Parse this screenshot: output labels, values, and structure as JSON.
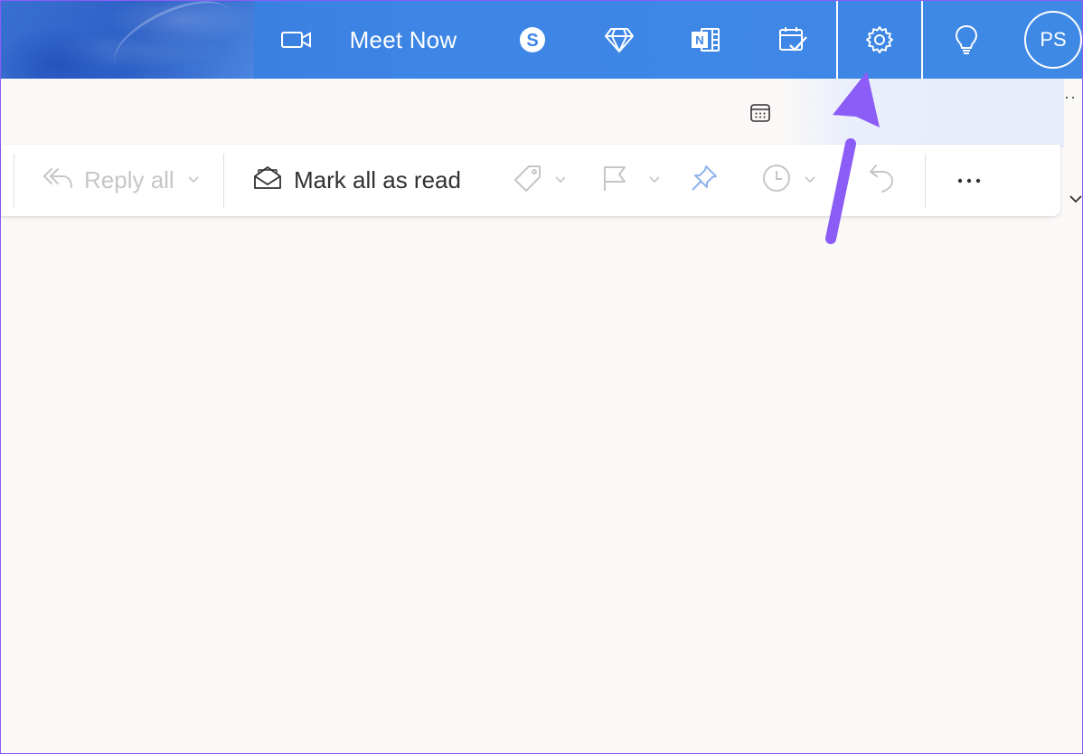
{
  "header": {
    "meet_now_label": "Meet Now",
    "avatar_initials": "PS",
    "icons": {
      "video": "video-camera-icon",
      "skype": "skype-icon",
      "premium": "diamond-icon",
      "onenote": "onenote-icon",
      "todo": "calendar-check-icon",
      "settings": "gear-icon",
      "tips": "lightbulb-icon"
    }
  },
  "toolbar": {
    "reply_all_label": "Reply all",
    "mark_all_read_label": "Mark all as read",
    "more_label": "···"
  },
  "colors": {
    "header_blue": "#3d86e6",
    "annotation_purple": "#8b5cf6",
    "disabled_gray": "#c8c6c4",
    "pin_blue": "#8fb2ec"
  }
}
